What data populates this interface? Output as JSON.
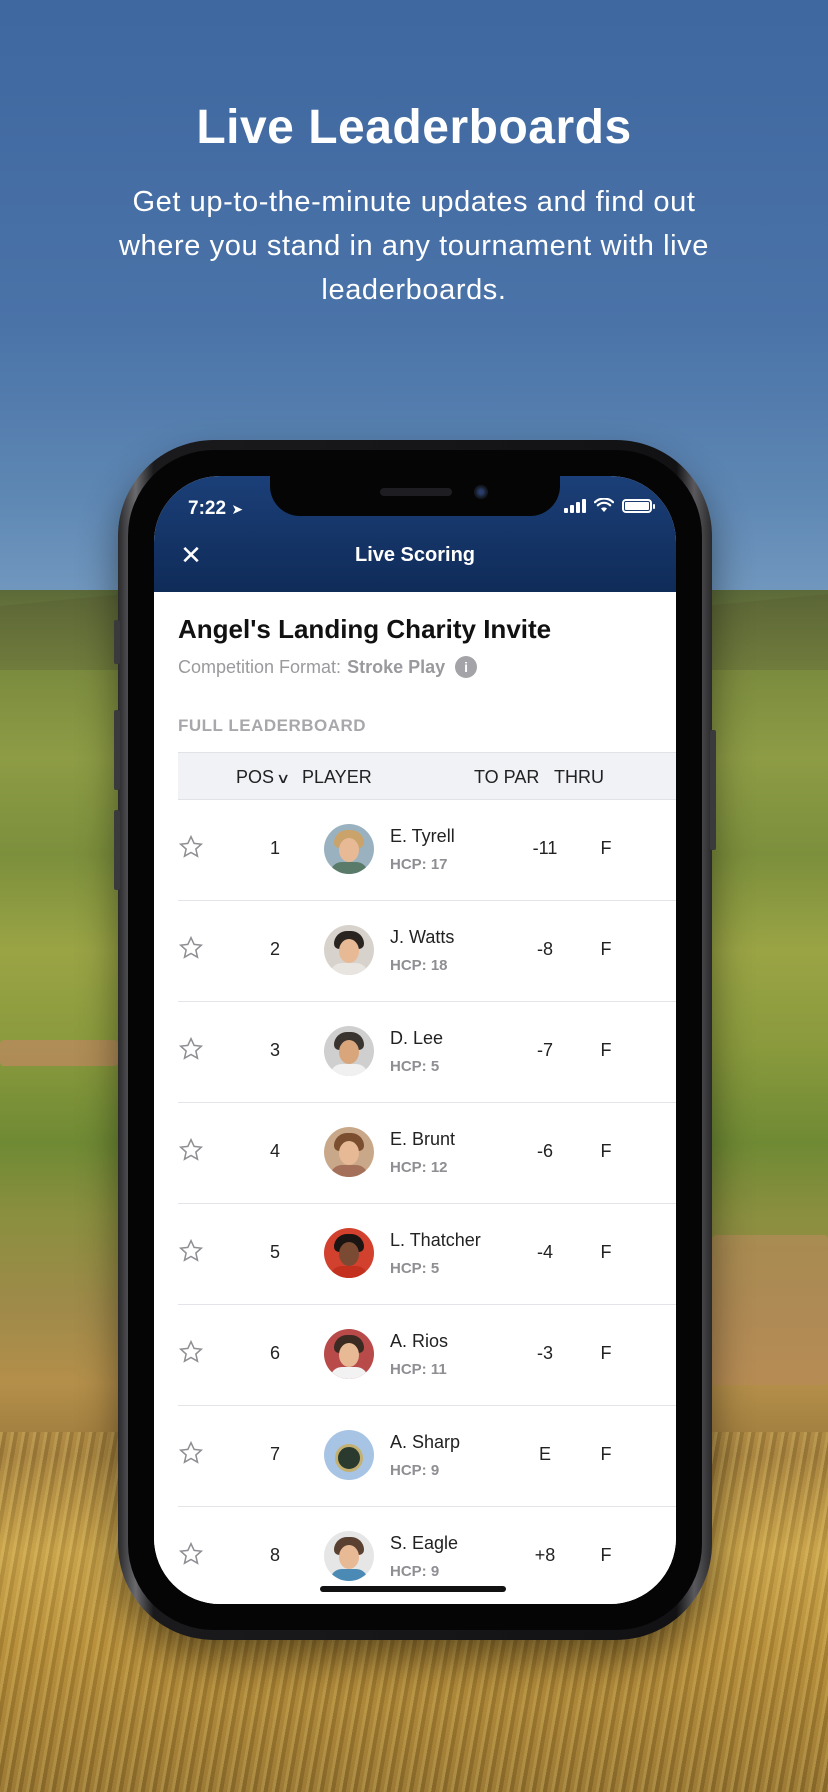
{
  "promo": {
    "headline": "Live Leaderboards",
    "subhead": "Get up-to-the-minute updates and find out where you stand in any tournament with live leaderboards."
  },
  "status_bar": {
    "time": "7:22",
    "location_icon": "location-arrow-icon",
    "signal_icon": "cellular-signal-icon",
    "wifi_icon": "wifi-icon",
    "battery_icon": "battery-icon"
  },
  "navbar": {
    "close_icon": "close-icon",
    "title": "Live Scoring",
    "background_color": "#14356a"
  },
  "event": {
    "title": "Angel's Landing Charity Invite",
    "format_label": "Competition Format:",
    "format_value": "Stroke Play",
    "info_icon": "info-icon"
  },
  "leaderboard": {
    "section_label": "FULL LEADERBOARD",
    "columns": {
      "pos": "POS",
      "player": "PLAYER",
      "to_par": "TO PAR",
      "thru": "THRU"
    },
    "rows": [
      {
        "pos": "1",
        "name": "E. Tyrell",
        "hcp": "HCP: 17",
        "to_par": "-11",
        "thru": "F"
      },
      {
        "pos": "2",
        "name": "J. Watts",
        "hcp": "HCP: 18",
        "to_par": "-8",
        "thru": "F"
      },
      {
        "pos": "3",
        "name": "D. Lee",
        "hcp": "HCP: 5",
        "to_par": "-7",
        "thru": "F"
      },
      {
        "pos": "4",
        "name": "E. Brunt",
        "hcp": "HCP: 12",
        "to_par": "-6",
        "thru": "F"
      },
      {
        "pos": "5",
        "name": "L. Thatcher",
        "hcp": "HCP: 5",
        "to_par": "-4",
        "thru": "F"
      },
      {
        "pos": "6",
        "name": "A. Rios",
        "hcp": "HCP: 11",
        "to_par": "-3",
        "thru": "F"
      },
      {
        "pos": "7",
        "name": "A. Sharp",
        "hcp": "HCP: 9",
        "to_par": "E",
        "thru": "F"
      },
      {
        "pos": "8",
        "name": "S. Eagle",
        "hcp": "HCP: 9",
        "to_par": "+8",
        "thru": "F"
      }
    ]
  }
}
